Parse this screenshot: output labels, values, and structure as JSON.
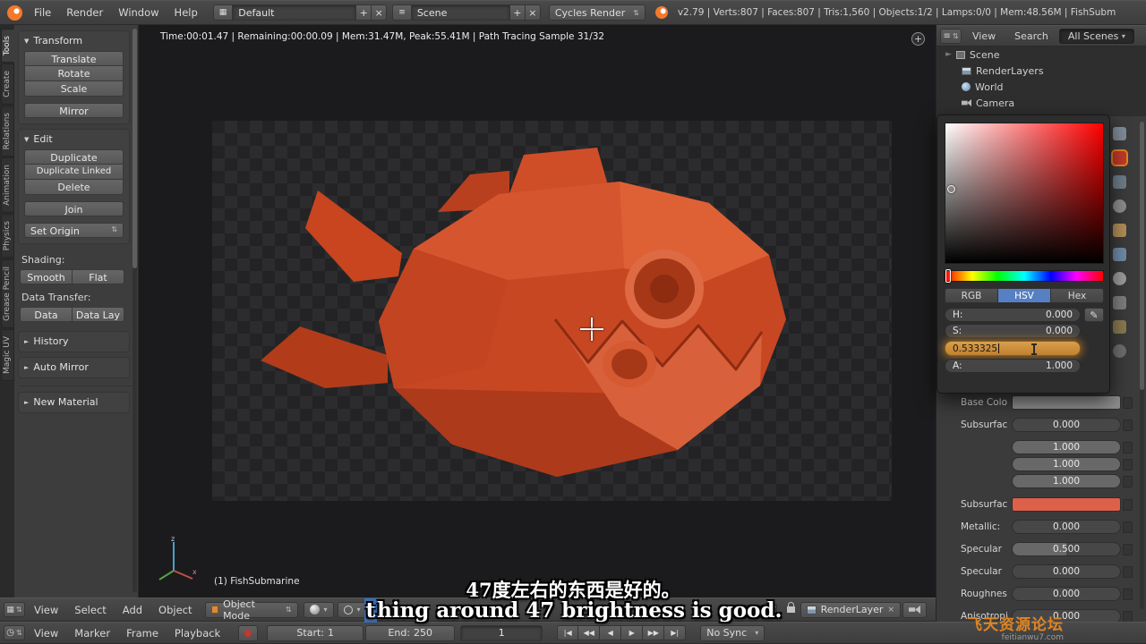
{
  "colors": {
    "base_color_swatch": "#8d8d8d",
    "subsurface_swatch": "#dc604a",
    "hsv_active_tab": "#5680c2",
    "watermark_orange": "#e08522",
    "subtitle_highlight": "#3a6fb5",
    "fish_orange": "#c84723"
  },
  "glyphs": {
    "tri_down": "▼",
    "tri_right": "►",
    "dropdown": "▾",
    "updown": "⇅",
    "plus": "+",
    "close": "×",
    "menu_lines": "≡",
    "grid": "▦",
    "clock": "◷",
    "eyedropper": "✎"
  },
  "top_bar": {
    "menus": [
      "File",
      "Render",
      "Window",
      "Help"
    ],
    "layout_name": "Default",
    "scene_name": "Scene",
    "engine": "Cycles Render",
    "stats": "v2.79 | Verts:807 | Faces:807 | Tris:1,560 | Objects:1/2 | Lamps:0/0 | Mem:48.56M | FishSubm"
  },
  "tool_tabs": [
    "Tools",
    "Create",
    "Relations",
    "Animation",
    "Physics",
    "Grease Pencil",
    "Magic UV"
  ],
  "tool_shelf": {
    "transform_title": "Transform",
    "translate": "Translate",
    "rotate": "Rotate",
    "scale": "Scale",
    "mirror": "Mirror",
    "edit_title": "Edit",
    "duplicate": "Duplicate",
    "duplicate_linked": "Duplicate Linked",
    "delete": "Delete",
    "join": "Join",
    "set_origin": "Set Origin",
    "shading_label": "Shading:",
    "smooth": "Smooth",
    "flat": "Flat",
    "data_transfer_label": "Data Transfer:",
    "data": "Data",
    "data_lay": "Data Lay",
    "history": "History",
    "auto_mirror": "Auto Mirror",
    "new_material": "New Material"
  },
  "viewport": {
    "render_stats": "Time:00:01.47 | Remaining:00:00.09 | Mem:31.47M, Peak:55.41M | Path Tracing Sample 31/32",
    "object_label": "(1) FishSubmarine"
  },
  "outliner": {
    "tabs": [
      "View",
      "Search",
      "All Scenes"
    ],
    "items": [
      {
        "label": "Scene"
      },
      {
        "label": "RenderLayers"
      },
      {
        "label": "World"
      },
      {
        "label": "Camera"
      }
    ]
  },
  "color_picker": {
    "tabs": [
      "RGB",
      "HSV",
      "Hex"
    ],
    "h_label": "H:",
    "h_value": "0.000",
    "s_label": "S:",
    "s_value": "0.000",
    "v_value": "0.533325",
    "a_label": "A:",
    "a_value": "1.000"
  },
  "properties": {
    "rows": [
      {
        "label": "Base Colo",
        "value": "",
        "fill": 0
      },
      {
        "label": "Subsurfac",
        "value": "0.000",
        "fill": 0
      },
      {
        "label": "",
        "value": "1.000",
        "fill": 100
      },
      {
        "label": "",
        "value": "1.000",
        "fill": 100
      },
      {
        "label": "",
        "value": "1.000",
        "fill": 100
      },
      {
        "label": "Subsurfac",
        "value": "",
        "fill": 0
      },
      {
        "label": "Metallic:",
        "value": "0.000",
        "fill": 0
      },
      {
        "label": "Specular",
        "value": "0.500",
        "fill": 50
      },
      {
        "label": "Specular",
        "value": "0.000",
        "fill": 0
      },
      {
        "label": "Roughnes",
        "value": "0.000",
        "fill": 0
      },
      {
        "label": "Anisotropi",
        "value": "0.000",
        "fill": 0
      }
    ]
  },
  "view3d_header": {
    "menus": [
      "View",
      "Select",
      "Add",
      "Object"
    ],
    "mode": "Object Mode",
    "render_layer": "RenderLayer"
  },
  "timeline": {
    "menus": [
      "View",
      "Marker",
      "Frame",
      "Playback"
    ],
    "start_label": "Start:",
    "start_value": "1",
    "end_label": "End:",
    "end_value": "250",
    "frame_value": "1",
    "sync": "No Sync",
    "playback": [
      "|◀",
      "◀◀",
      "◀",
      "▶",
      "▶▶",
      "▶|"
    ]
  },
  "subtitles": {
    "chinese": "47度左右的东西是好的。",
    "english_hl": "t",
    "english_rest": "hing around 47 brightness is good."
  },
  "watermark": {
    "title": "飞天资源论坛",
    "url": "feitianwu7.com"
  }
}
